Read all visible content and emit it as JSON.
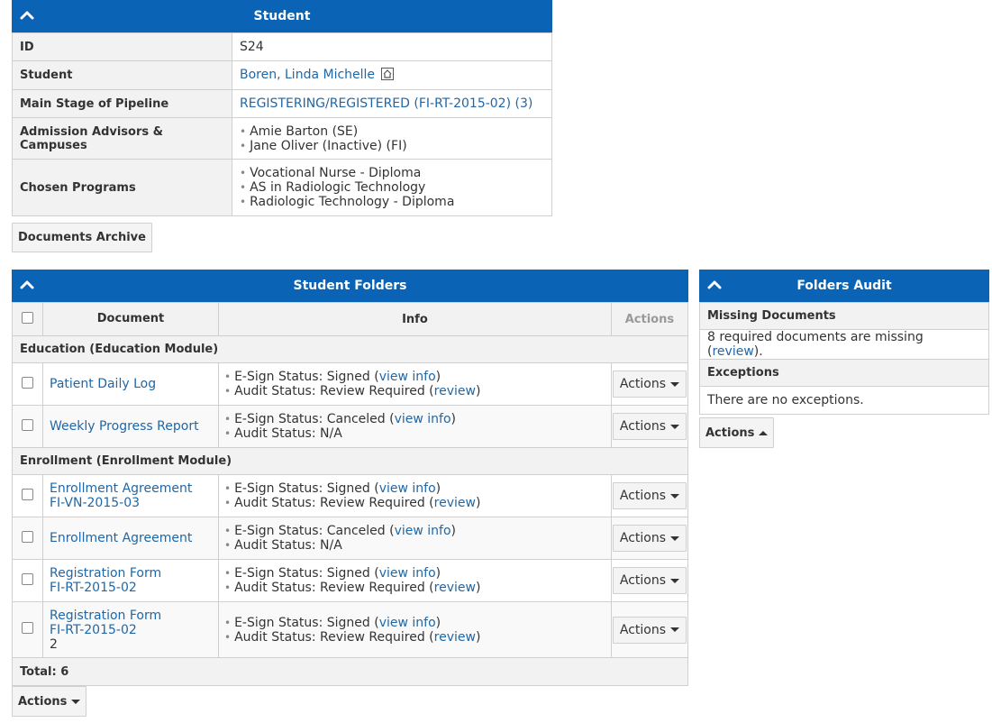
{
  "student_panel": {
    "title": "Student",
    "rows": [
      {
        "label": "ID",
        "value": "S24"
      },
      {
        "label": "Student",
        "value": "Boren, Linda Michelle"
      },
      {
        "label": "Main Stage of Pipeline",
        "value": "REGISTERING/REGISTERED (FI-RT-2015-02) (3)"
      },
      {
        "label": "Admission Advisors & Campuses",
        "items": [
          "Amie Barton (SE)",
          "Jane Oliver (Inactive) (FI)"
        ]
      },
      {
        "label": "Chosen Programs",
        "items": [
          "Vocational Nurse - Diploma",
          "AS in Radiologic Technology",
          "Radiologic Technology - Diploma"
        ]
      }
    ]
  },
  "documents_archive_button": "Documents Archive",
  "folders_panel": {
    "title": "Student Folders",
    "columns": {
      "document": "Document",
      "info": "Info",
      "actions": "Actions"
    },
    "groups": [
      {
        "name": "Education (Education Module)",
        "docs": [
          {
            "name_lines": [
              "Patient Daily Log"
            ],
            "esign_label": "E-Sign Status: Signed",
            "esign_link": "view info",
            "audit_label": "Audit Status: Review Required",
            "audit_link": "review",
            "action_label": "Actions"
          },
          {
            "name_lines": [
              "Weekly Progress Report"
            ],
            "esign_label": "E-Sign Status: Canceled",
            "esign_link": "view info",
            "audit_label": "Audit Status: N/A",
            "audit_link": "",
            "action_label": "Actions"
          }
        ]
      },
      {
        "name": "Enrollment (Enrollment Module)",
        "docs": [
          {
            "name_lines": [
              "Enrollment Agreement",
              "FI-VN-2015-03"
            ],
            "esign_label": "E-Sign Status: Signed",
            "esign_link": "view info",
            "audit_label": "Audit Status: Review Required",
            "audit_link": "review",
            "action_label": "Actions"
          },
          {
            "name_lines": [
              "Enrollment Agreement"
            ],
            "esign_label": "E-Sign Status: Canceled",
            "esign_link": "view info",
            "audit_label": "Audit Status: N/A",
            "audit_link": "",
            "action_label": "Actions"
          },
          {
            "name_lines": [
              "Registration Form",
              "FI-RT-2015-02"
            ],
            "esign_label": "E-Sign Status: Signed",
            "esign_link": "view info",
            "audit_label": "Audit Status: Review Required",
            "audit_link": "review",
            "action_label": "Actions"
          },
          {
            "name_lines": [
              "Registration Form",
              "FI-RT-2015-02"
            ],
            "name_suffix": "2",
            "esign_label": "E-Sign Status: Signed",
            "esign_link": "view info",
            "audit_label": "Audit Status: Review Required",
            "audit_link": "review",
            "action_label": "Actions"
          }
        ]
      }
    ],
    "total": "Total: 6",
    "footer_action": "Actions"
  },
  "audit_panel": {
    "title": "Folders Audit",
    "missing_header": "Missing Documents",
    "missing_text_before": "8 required documents are missing (",
    "missing_link": "review",
    "missing_text_after": ").",
    "exceptions_header": "Exceptions",
    "exceptions_text": "There are no exceptions.",
    "action_label": "Actions"
  },
  "icons": {
    "collapse": "chevron-up-icon",
    "home": "home-icon",
    "dropdown": "caret-down-icon",
    "dropup": "caret-up-icon"
  },
  "colors": {
    "header": "#0a63b5",
    "link": "#1f67a6"
  }
}
